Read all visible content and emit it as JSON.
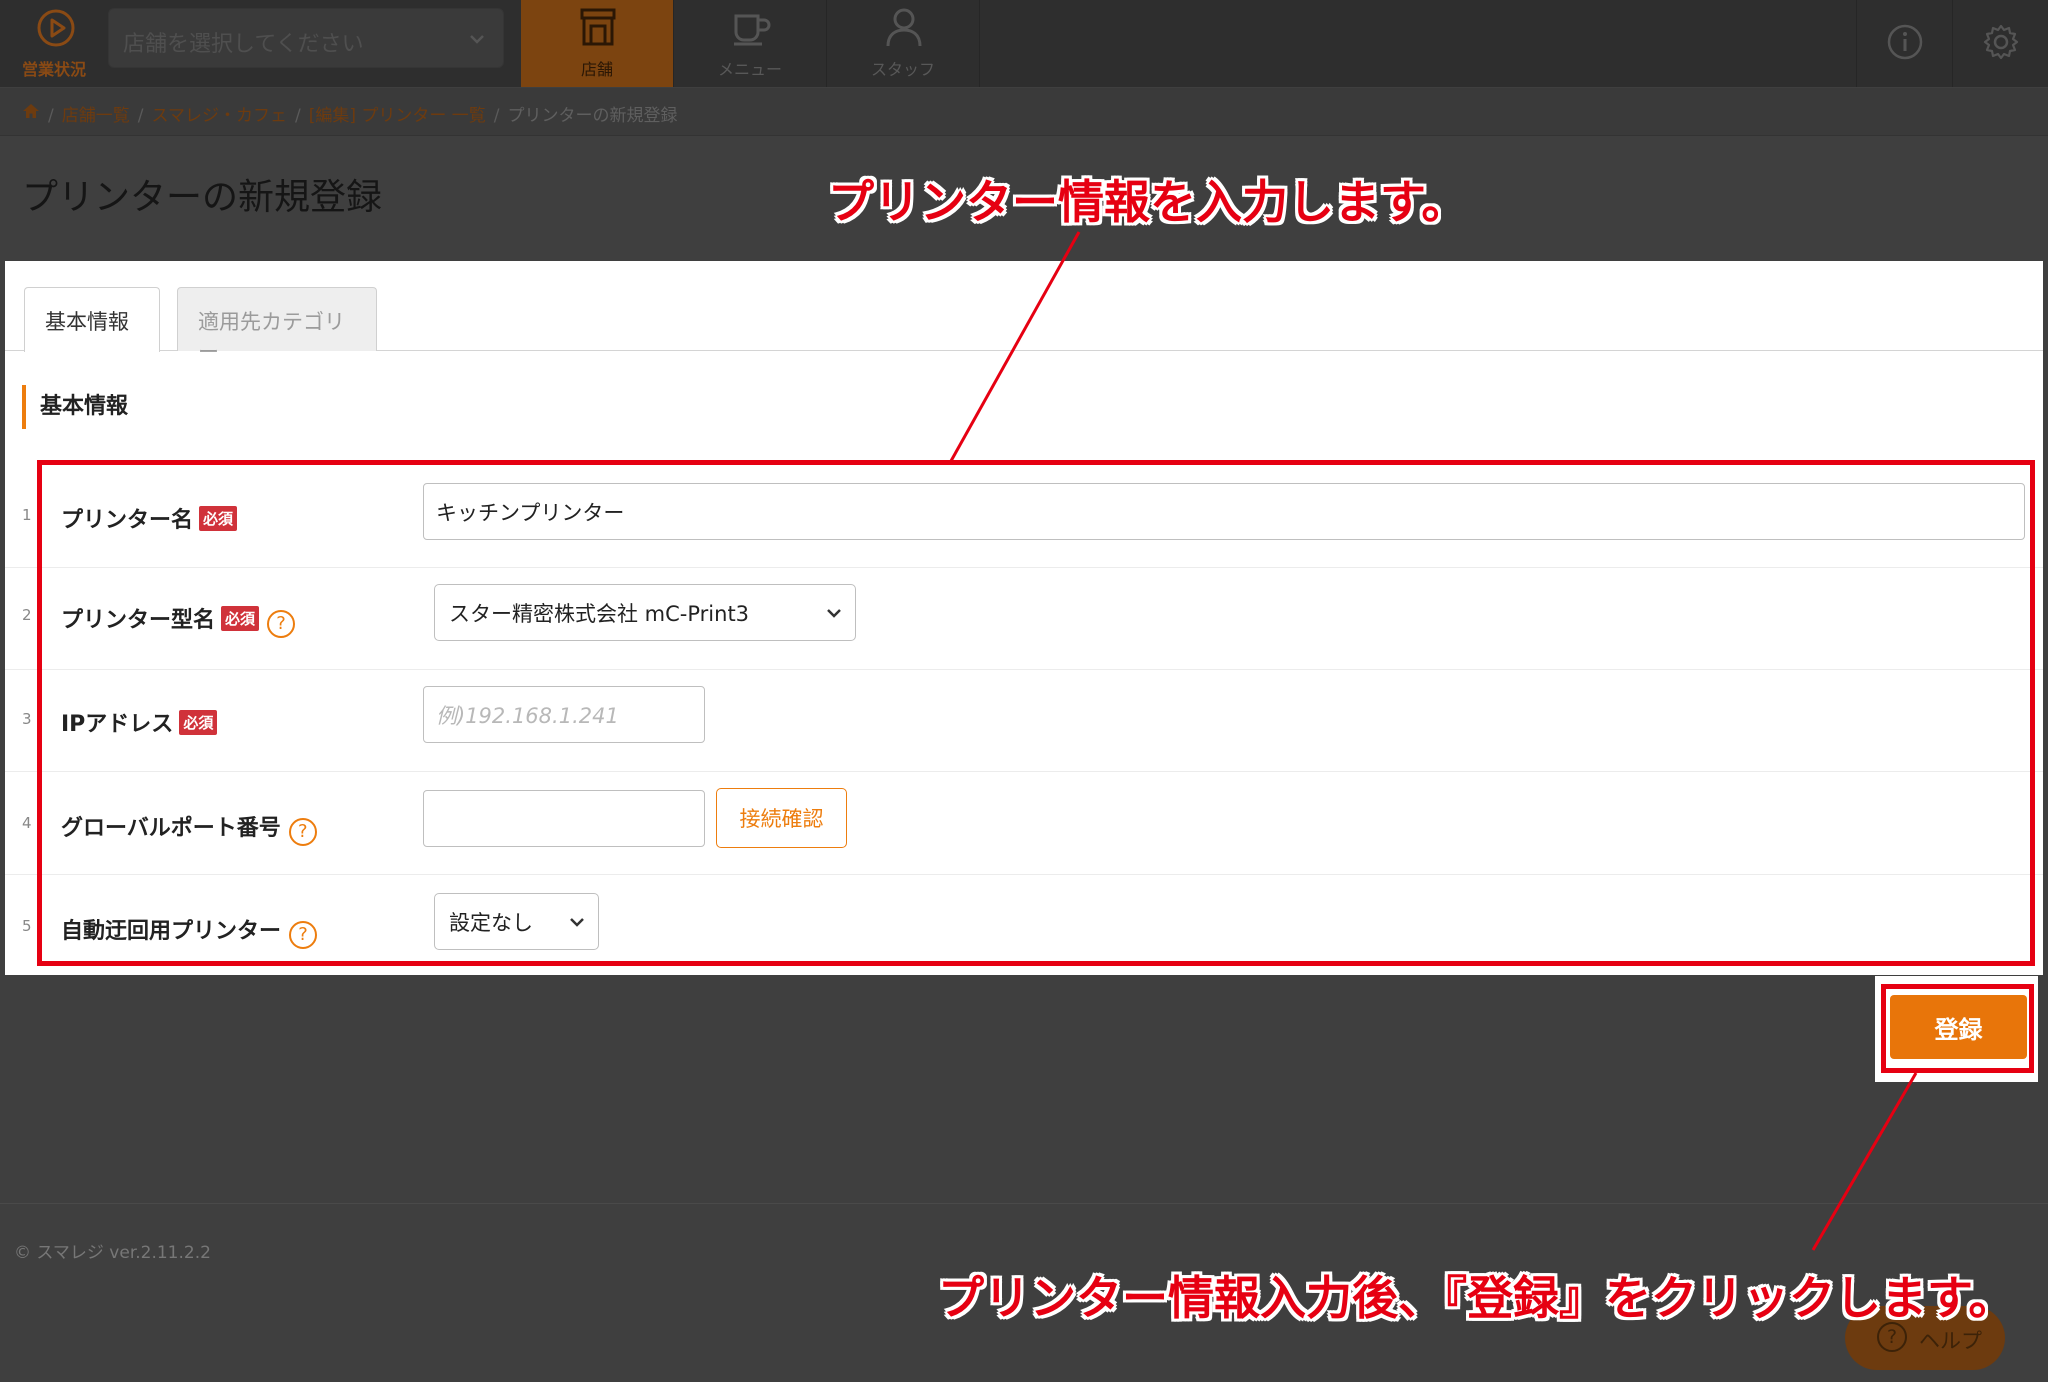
{
  "topnav": {
    "status_label": "営業状況",
    "store_select_placeholder": "店舗を選択してください",
    "tabs": [
      {
        "label": "店舗",
        "active": true
      },
      {
        "label": "メニュー",
        "active": false
      },
      {
        "label": "スタッフ",
        "active": false
      }
    ]
  },
  "breadcrumb": {
    "items": [
      "店舗一覧",
      "スマレジ・カフェ",
      "[編集] プリンター 一覧"
    ],
    "current": "プリンターの新規登録",
    "separator": "/"
  },
  "page": {
    "title": "プリンターの新規登録"
  },
  "tabs": {
    "basic": "基本情報",
    "category": "適用先カテゴリー"
  },
  "section": {
    "title": "基本情報"
  },
  "form": {
    "required_badge": "必須",
    "help_glyph": "?",
    "rows": [
      {
        "num": "1",
        "label": "プリンター名",
        "value": "キッチンプリンター"
      },
      {
        "num": "2",
        "label": "プリンター型名",
        "value": "スター精密株式会社 mC-Print3"
      },
      {
        "num": "3",
        "label": "IPアドレス",
        "placeholder": "例)192.168.1.241"
      },
      {
        "num": "4",
        "label": "グローバルポート番号",
        "button": "接続確認"
      },
      {
        "num": "5",
        "label": "自動迂回用プリンター",
        "value": "設定なし"
      }
    ]
  },
  "actions": {
    "register": "登録"
  },
  "footer": {
    "version": "© スマレジ ver.2.11.2.2",
    "help": "ヘルプ"
  },
  "annotations": {
    "form_callout": "プリンター情報を入力します。",
    "register_callout": "プリンター情報入力後、『登録』をクリックします。"
  },
  "colors": {
    "accent": "#ed7d0e",
    "highlight": "#e60012",
    "required": "#d0323a"
  }
}
